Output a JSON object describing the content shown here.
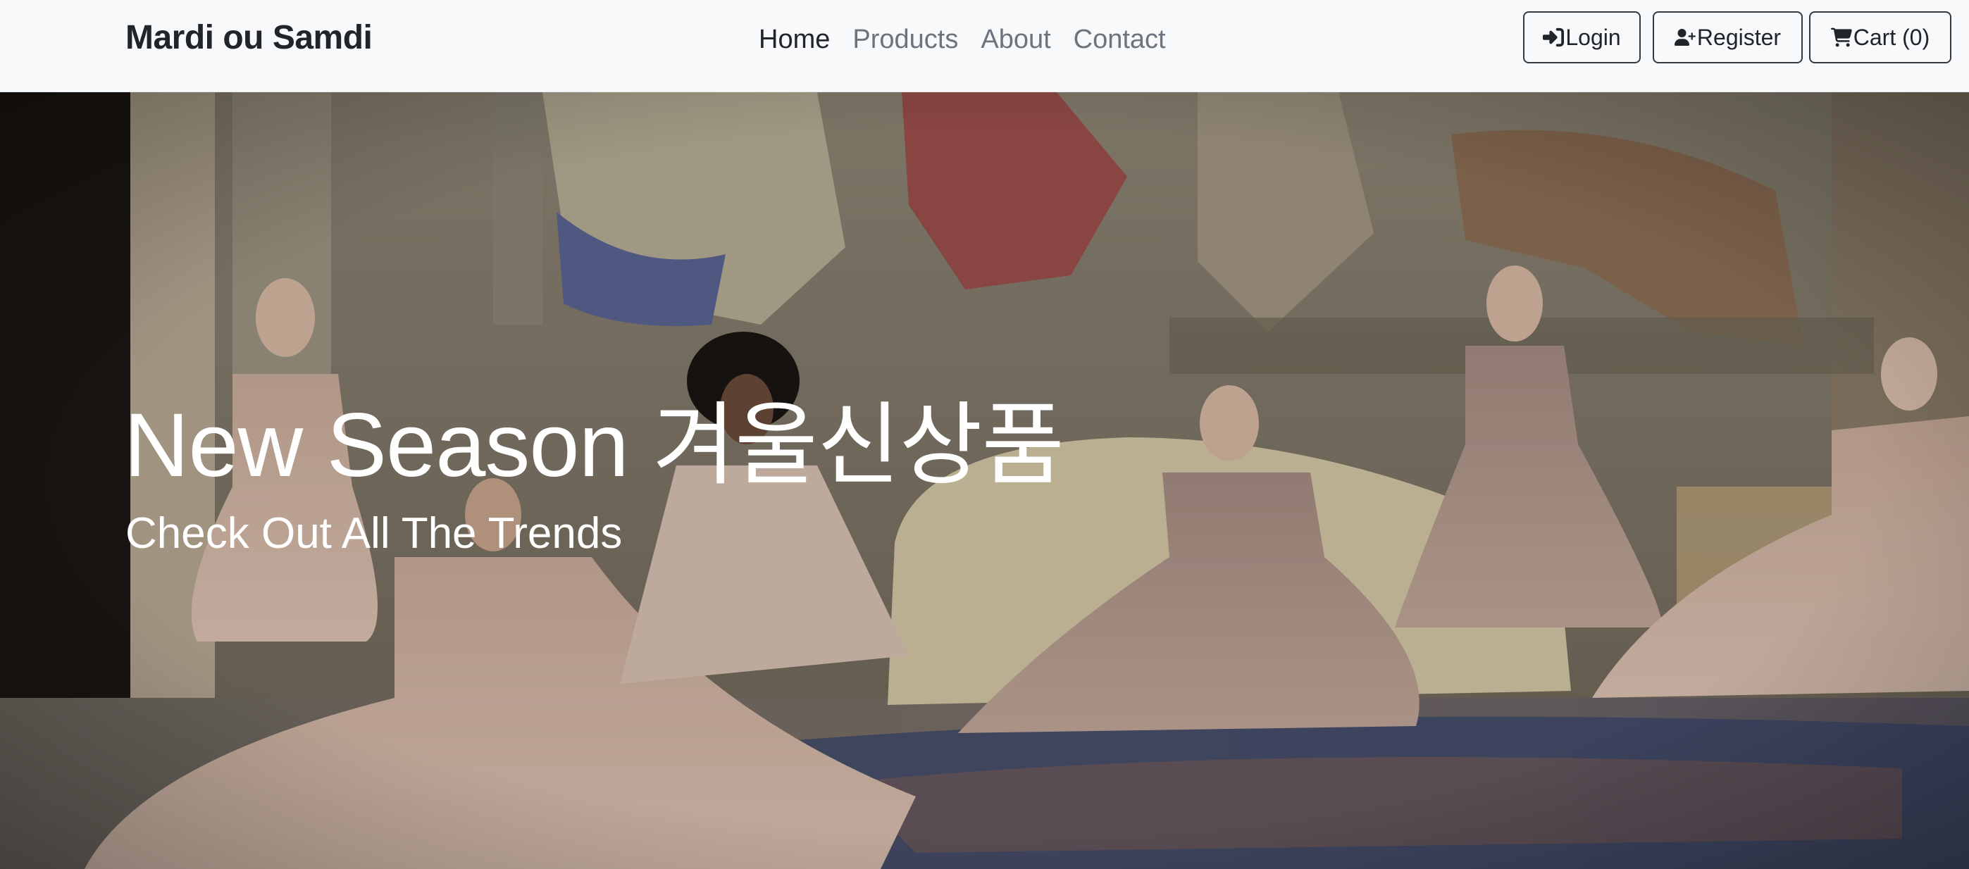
{
  "navbar": {
    "brand": "Mardi ou Samdi",
    "links": [
      {
        "label": "Home",
        "active": true
      },
      {
        "label": "Products",
        "active": false
      },
      {
        "label": "About",
        "active": false
      },
      {
        "label": "Contact",
        "active": false
      }
    ],
    "buttons": {
      "login": {
        "label": "Login",
        "icon": "sign-in-icon"
      },
      "register": {
        "label": "Register",
        "icon": "user-plus-icon"
      },
      "cart": {
        "label": "Cart (0)",
        "icon": "cart-icon"
      }
    }
  },
  "hero": {
    "title": "New Season 겨울신상품",
    "subtitle": "Check Out All The Trends",
    "image_subject": "models in pale pink gowns seated before a fresco-painted wall on an ornate rug"
  },
  "colors": {
    "navbar_bg": "#f8f9fa",
    "text_dark": "#212529",
    "text_muted": "#6c757d",
    "hero_text": "#ffffff"
  }
}
